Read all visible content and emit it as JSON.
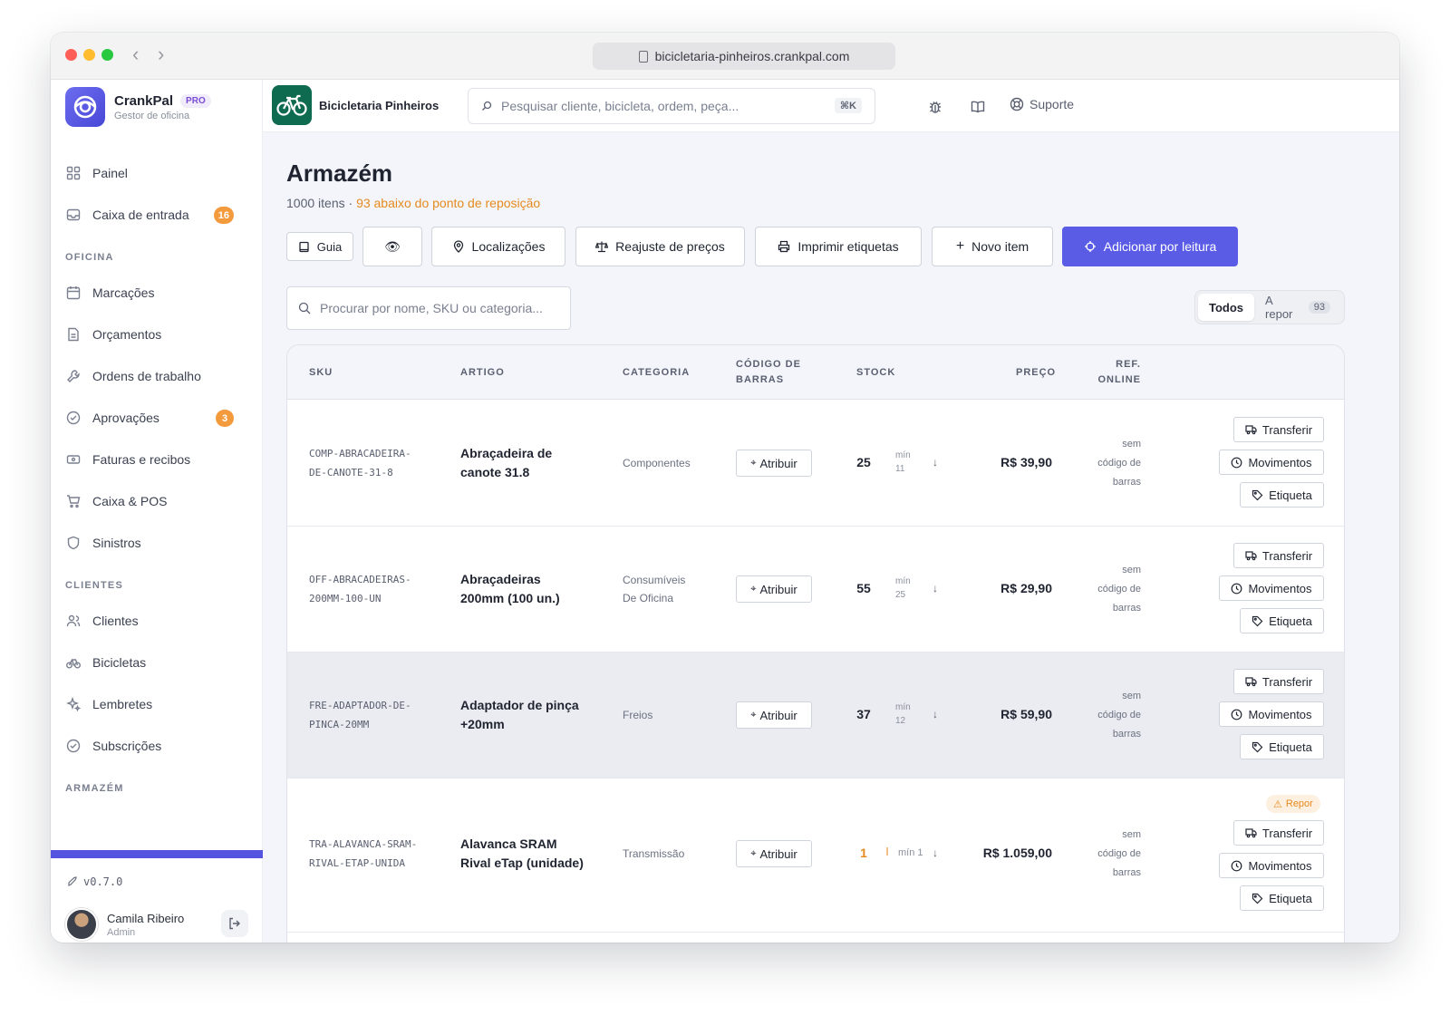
{
  "browser": {
    "url": "bicicletaria-pinheiros.crankpal.com"
  },
  "brand": {
    "name": "CrankPal",
    "badge": "PRO",
    "subtitle": "Gestor de oficina"
  },
  "shop": {
    "name": "Bicicletaria Pinheiros"
  },
  "search": {
    "placeholder": "Pesquisar cliente, bicicleta, ordem, peça...",
    "shortcut": "⌘K"
  },
  "topbar": {
    "support_label": "Suporte"
  },
  "sidebar": {
    "items": [
      {
        "label": "Painel",
        "icon": "grid-icon"
      },
      {
        "label": "Caixa de entrada",
        "icon": "inbox-icon",
        "badge": "16"
      }
    ],
    "sections": [
      {
        "title": "OFICINA",
        "items": [
          {
            "label": "Marcações",
            "icon": "calendar-icon"
          },
          {
            "label": "Orçamentos",
            "icon": "document-icon"
          },
          {
            "label": "Ordens de trabalho",
            "icon": "wrench-icon"
          },
          {
            "label": "Aprovações",
            "icon": "check-circle-icon",
            "badge": "3"
          },
          {
            "label": "Faturas e recibos",
            "icon": "receipt-icon"
          },
          {
            "label": "Caixa & POS",
            "icon": "cart-icon"
          },
          {
            "label": "Sinistros",
            "icon": "shield-icon"
          }
        ]
      },
      {
        "title": "CLIENTES",
        "items": [
          {
            "label": "Clientes",
            "icon": "users-icon"
          },
          {
            "label": "Bicicletas",
            "icon": "bicycle-icon"
          },
          {
            "label": "Lembretes",
            "icon": "sparkle-icon"
          },
          {
            "label": "Subscrições",
            "icon": "check-circle-icon"
          }
        ]
      },
      {
        "title": "ARMAZÉM",
        "items": []
      }
    ],
    "version": "v0.7.0",
    "user": {
      "name": "Camila Ribeiro",
      "role": "Admin"
    }
  },
  "page": {
    "title": "Armazém",
    "count_text": "1000 itens · ",
    "warning_text": "93 abaixo do ponto de reposição"
  },
  "toolbar": {
    "guide": "Guia",
    "locations": "Localizações",
    "price_adjust": "Reajuste de preços",
    "print_labels": "Imprimir etiquetas",
    "new_item": "Novo item",
    "add_by_scan": "Adicionar por leitura"
  },
  "filter": {
    "placeholder": "Procurar por nome, SKU ou categoria...",
    "segments": [
      {
        "label": "Todos"
      },
      {
        "label": "A repor",
        "count": "93"
      }
    ]
  },
  "table": {
    "headers": {
      "sku": "SKU",
      "article": "ARTIGO",
      "category": "CATEGORIA",
      "barcode_1": "CÓDIGO DE",
      "barcode_2": "BARRAS",
      "stock": "STOCK",
      "price": "PREÇO",
      "ref_1": "REF.",
      "ref_2": "ONLINE"
    },
    "actions": {
      "transfer": "Transferir",
      "movements": "Movimentos",
      "label": "Etiqueta",
      "assign": "Atribuir",
      "repor": "Repor"
    },
    "rows": [
      {
        "sku_1": "COMP-ABRACADEIRA-",
        "sku_2": "DE-CANOTE-31-8",
        "art_1": "Abraçadeira de",
        "art_2": "canote 31.8",
        "cat_1": "Componentes",
        "cat_2": "",
        "stock": "25",
        "min_1": "mín",
        "min_2": "11",
        "price": "R$ 39,90",
        "ref_1": "sem",
        "ref_2": "código de",
        "ref_3": "barras"
      },
      {
        "sku_1": "OFF-ABRACADEIRAS-",
        "sku_2": "200MM-100-UN",
        "art_1": "Abraçadeiras",
        "art_2": "200mm (100 un.)",
        "cat_1": "Consumíveis",
        "cat_2": "De Oficina",
        "stock": "55",
        "min_1": "mín",
        "min_2": "25",
        "price": "R$ 29,90",
        "ref_1": "sem",
        "ref_2": "código de",
        "ref_3": "barras"
      },
      {
        "sku_1": "FRE-ADAPTADOR-DE-",
        "sku_2": "PINCA-20MM",
        "art_1": "Adaptador de pinça",
        "art_2": "+20mm",
        "cat_1": "Freios",
        "cat_2": "",
        "stock": "37",
        "min_1": "mín",
        "min_2": "12",
        "price": "R$ 59,90",
        "ref_1": "sem",
        "ref_2": "código de",
        "ref_3": "barras"
      },
      {
        "sku_1": "TRA-ALAVANCA-SRAM-",
        "sku_2": "RIVAL-ETAP-UNIDA",
        "art_1": "Alavanca SRAM",
        "art_2": "Rival eTap (unidade)",
        "cat_1": "Transmissão",
        "cat_2": "",
        "stock": "1",
        "min_1": "mín 1",
        "min_2": "",
        "price": "R$ 1.059,00",
        "ref_1": "sem",
        "ref_2": "código de",
        "ref_3": "barras"
      }
    ]
  },
  "colors": {
    "accent": "#5a5ce6",
    "warning": "#e58a1f",
    "brand_green": "#0f6b4f"
  }
}
